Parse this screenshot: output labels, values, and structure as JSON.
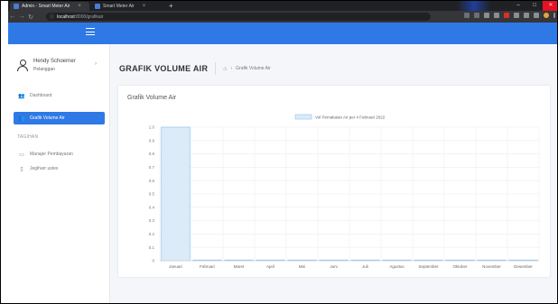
{
  "browser": {
    "tabs": [
      {
        "title": "Admin - Smart Meter Air",
        "active": true
      },
      {
        "title": "Smart Meter Air",
        "active": false
      }
    ],
    "url_host": "localhost",
    "url_path": ":8000/grafikair"
  },
  "user": {
    "name": "Hendy Schoerner",
    "role": "Pelanggan"
  },
  "sidebar": {
    "items": [
      {
        "label": "Dashboard",
        "icon": "users-icon",
        "active": false
      },
      {
        "label": "Grafik Volume Air",
        "icon": "users-icon",
        "active": true
      }
    ],
    "section_label": "TAGIHAN",
    "section_items": [
      {
        "label": "Manajer Pembayaran",
        "icon": "card-icon"
      },
      {
        "label": "Jegiharr ustes",
        "icon": "doc-icon"
      }
    ]
  },
  "page": {
    "title": "GRAFIK VOLUME AIR",
    "breadcrumb": "Grafik Volume Air"
  },
  "card": {
    "title": "Grafik Volume Air"
  },
  "colors": {
    "primary": "#2f79e6",
    "bar_fill": "#dcebf8",
    "bar_stroke": "#92c2ec"
  },
  "chart_data": {
    "type": "bar",
    "title": "",
    "xlabel": "",
    "ylabel": "",
    "legend_position": "top-center",
    "ylim": [
      0,
      1.0
    ],
    "yticks": [
      "1.0",
      "0.9",
      "0.8",
      "0.7",
      "0.6",
      "0.5",
      "0.4",
      "0.3",
      "0.2",
      "0.1",
      "0"
    ],
    "categories": [
      "Januari",
      "Februari",
      "Maret",
      "April",
      "Mei",
      "Juni",
      "Juli",
      "Agustus",
      "September",
      "Oktober",
      "November",
      "Desember"
    ],
    "series": [
      {
        "name": "Vol Pemakaian Air per 4 Februari 2022",
        "values": [
          1,
          0,
          0,
          0,
          0,
          0,
          0,
          0,
          0,
          0,
          0,
          0
        ]
      }
    ],
    "grid": true
  }
}
